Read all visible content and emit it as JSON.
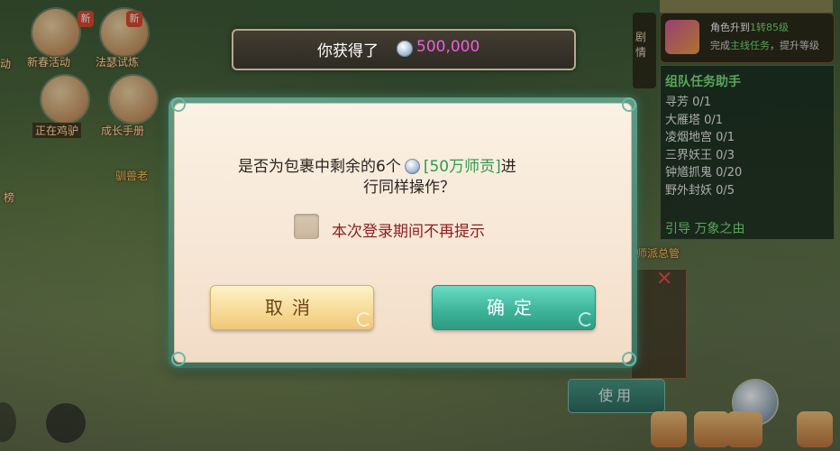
{
  "background": {
    "left_icons": [
      {
        "label": "新春活动",
        "badge": "新"
      },
      {
        "label": "法瑟试炼",
        "badge": "新"
      },
      {
        "label": "正在鸡驴",
        "badge": ""
      },
      {
        "label": "成长手册",
        "badge": ""
      },
      {
        "label": "榜",
        "badge": ""
      },
      {
        "label": "驯兽老",
        "badge": ""
      },
      {
        "label": "动",
        "badge": ""
      }
    ],
    "side_tab_label": "剧情",
    "hud": {
      "line1_prefix": "角色升到",
      "line1_highlight": "1转85级",
      "line2_prefix": "完成",
      "line2_highlight": "主线任务",
      "line2_suffix": "，提升等级"
    },
    "task_panel": {
      "title": "组队任务助手",
      "tasks": [
        "寻芳 0/1",
        "大雁塔 0/1",
        "凌烟地宫 0/1",
        "三界妖王 0/3",
        "钟馗抓鬼 0/20",
        "野外封妖 0/5"
      ],
      "guide": "引导 万象之由"
    },
    "faction_label": "师派总管",
    "use_button": "使用"
  },
  "banner": {
    "prefix": "你获得了",
    "coin_icon": "silver-coin-icon",
    "amount": "500,000"
  },
  "dialog": {
    "message_part1": "是否为包裹中剩余的6个",
    "item_name": "[50万师贡]",
    "message_part2": "进",
    "message_line2": "行同样操作？",
    "checkbox_label": "本次登录期间不再提示",
    "checkbox_checked": false,
    "cancel_label": "取消",
    "confirm_label": "确定"
  },
  "colors": {
    "item_green": "#2f9a4c",
    "amount_pink": "#ee5ddc",
    "checkbox_label_red": "#8a1f1f",
    "confirm_teal": "#3fb59c",
    "cancel_gold": "#f7dc98"
  }
}
